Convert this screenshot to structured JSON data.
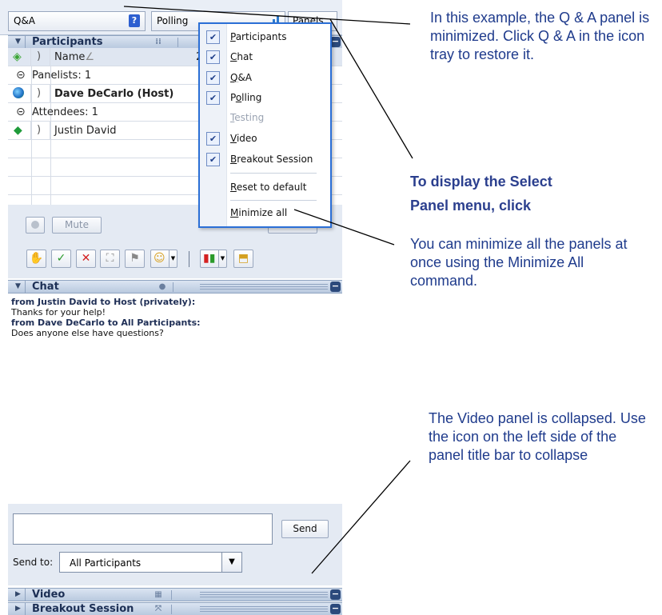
{
  "tray": {
    "qa_label": "Q&A",
    "polling_label": "Polling",
    "panels_label": "Panels"
  },
  "participants": {
    "title": "Participants",
    "name_column": "Name",
    "sort_indicator": "∠",
    "count": "2",
    "panelists_header": "Panelists: 1",
    "host_name": "Dave DeCarlo (Host)",
    "attendees_header": "Attendees: 1",
    "attendee_name": "Justin David"
  },
  "controls": {
    "mute_label": "Mute"
  },
  "menu": {
    "items": [
      {
        "label": "Participants",
        "accel": "P",
        "rest": "articipants",
        "checked": true,
        "enabled": true
      },
      {
        "label": "Chat",
        "accel": "C",
        "rest": "hat",
        "checked": true,
        "enabled": true
      },
      {
        "label": "Q&A",
        "accel": "Q",
        "rest": "&A",
        "checked": true,
        "enabled": true
      },
      {
        "label": "Polling",
        "accel": "o",
        "pre": "P",
        "rest": "lling",
        "checked": true,
        "enabled": true
      },
      {
        "label": "Testing",
        "accel": "T",
        "rest": "esting",
        "checked": false,
        "enabled": false
      },
      {
        "label": "Video",
        "accel": "V",
        "rest": "ideo",
        "checked": true,
        "enabled": true
      },
      {
        "label": "Breakout Session",
        "accel": "B",
        "rest": "reakout Session",
        "checked": true,
        "enabled": true
      },
      {
        "label": "Reset to default",
        "accel": "R",
        "rest": "eset to default",
        "checked": false,
        "enabled": true
      },
      {
        "label": "Minimize all",
        "accel": "M",
        "rest": "inimize all",
        "checked": false,
        "enabled": true
      }
    ]
  },
  "chat": {
    "title": "Chat",
    "messages": [
      {
        "from": "from Justin David to Host (privately):",
        "text": "Thanks for your help!"
      },
      {
        "from": "from Dave DeCarlo to All Participants:",
        "text": "Does anyone else have questions?"
      }
    ],
    "send_label": "Send",
    "send_to_label": "Send to:",
    "send_to_value": "All Participants"
  },
  "collapsed_panels": {
    "video": "Video",
    "breakout": "Breakout Session"
  },
  "annotations": {
    "qa_note": "In this example, the Q & A panel is minimized. Click Q & A in the icon tray to restore it.",
    "select_panel_line1": "To display the Select",
    "select_panel_line2": "Panel menu, click",
    "minimize_note": "You can minimize all the panels at once using the Minimize All command.",
    "video_note": "The Video panel is collapsed. Use the icon on the left side of the panel title bar to collapse"
  }
}
